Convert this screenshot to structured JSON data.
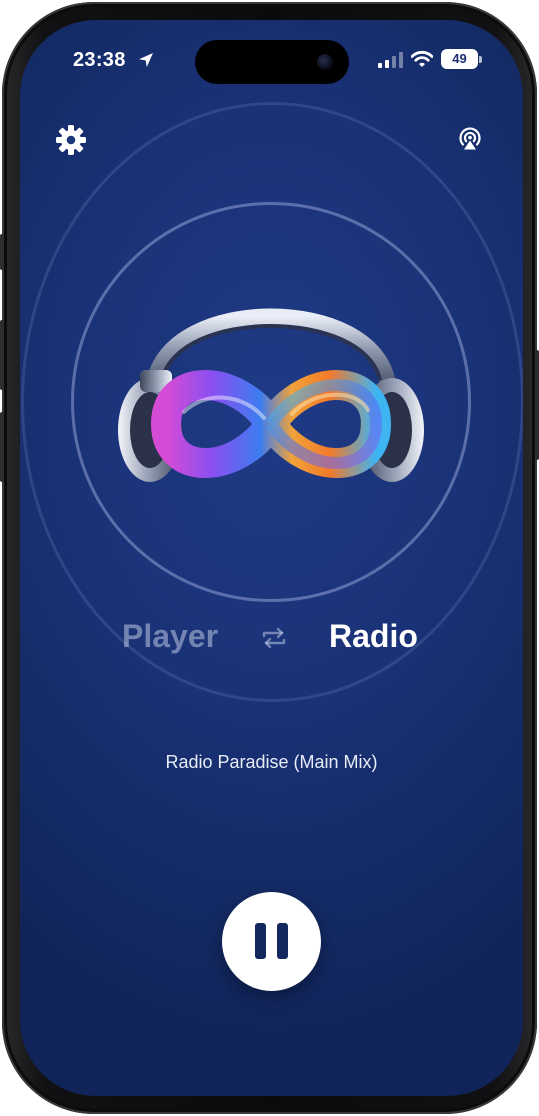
{
  "status_bar": {
    "time": "23:38",
    "battery": "49",
    "location_icon": "location-arrow-icon",
    "signal_icon": "cellular-signal-icon",
    "wifi_icon": "wifi-icon"
  },
  "toolbar": {
    "settings_icon": "gear-icon",
    "airplay_icon": "airplay-icon"
  },
  "mode_switch": {
    "left_label": "Player",
    "right_label": "Radio",
    "active": "Radio",
    "swap_icon": "swap-arrows-icon"
  },
  "now_playing": {
    "station": "Radio Paradise (Main Mix)"
  },
  "controls": {
    "pause_icon": "pause-icon"
  },
  "colors": {
    "background": "#1a3277",
    "ring": "#95a7e0",
    "inactive_text": "#bec8e1",
    "active_text": "#ffffff",
    "pause_button": "#ffffff",
    "pause_glyph": "#15285e"
  }
}
